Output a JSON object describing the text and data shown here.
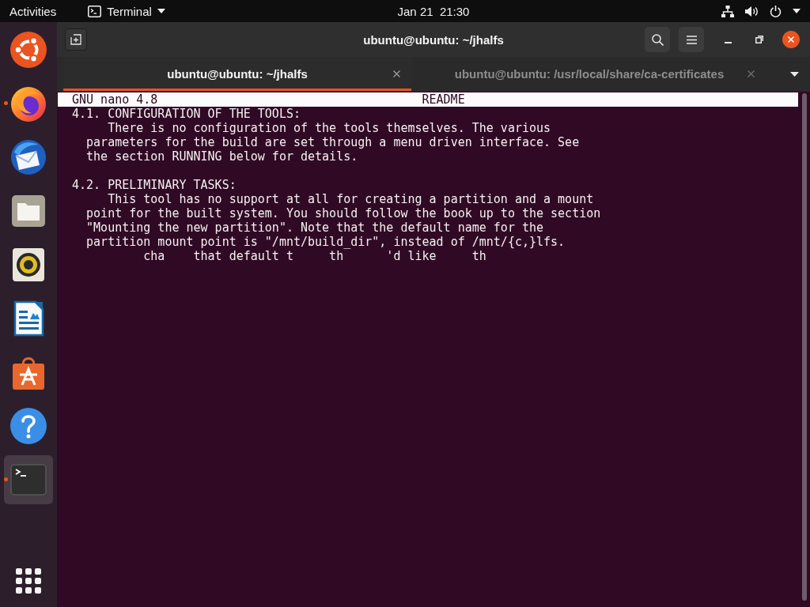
{
  "top_bar": {
    "activities": "Activities",
    "app_menu": "Terminal",
    "clock": "Jan 21  21:30"
  },
  "dock": {
    "items": [
      {
        "kind": "logo",
        "running": false,
        "selected": false
      },
      {
        "kind": "browser",
        "running": true,
        "selected": false
      },
      {
        "kind": "mail",
        "running": false,
        "selected": false
      },
      {
        "kind": "files",
        "running": false,
        "selected": false
      },
      {
        "kind": "audio",
        "running": false,
        "selected": false
      },
      {
        "kind": "document",
        "running": false,
        "selected": false
      },
      {
        "kind": "store",
        "running": false,
        "selected": false
      },
      {
        "kind": "help",
        "running": false,
        "selected": false
      },
      {
        "kind": "terminal",
        "running": true,
        "selected": true
      }
    ]
  },
  "window": {
    "title": "ubuntu@ubuntu: ~/jhalfs"
  },
  "tabs": [
    {
      "label": "ubuntu@ubuntu: ~/jhalfs",
      "selected": true
    },
    {
      "label": "ubuntu@ubuntu: /usr/local/share/ca-certificates",
      "selected": false
    }
  ],
  "editor": {
    "program": "GNU nano 4.8",
    "file": "README",
    "sections": [
      {
        "heading": "4.1. CONFIGURATION OF THE TOOLS:",
        "lines": [
          "     There is no configuration of the tools themselves. The various",
          "  parameters for the build are set through a menu driven interface. See",
          "  the section RUNNING below for details."
        ]
      },
      {
        "heading": "4.2. PRELIMINARY TASKS:",
        "lines": [
          "     This tool has no support at all for creating a partition and a mount",
          "  point for the built system. You should follow the book up to the section",
          "  \"Mounting the new partition\". Note that the default name for the",
          "  partition mount point is \"/mnt/build_dir\", instead of /mnt/{c,}lfs.",
          "          cha    that default t     th      'd like     th"
        ]
      }
    ]
  }
}
